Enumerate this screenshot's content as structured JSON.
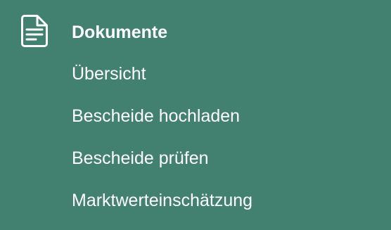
{
  "section": {
    "icon": "document-icon",
    "title": "Dokumente",
    "items": [
      {
        "label": "Übersicht"
      },
      {
        "label": "Bescheide hochladen"
      },
      {
        "label": "Bescheide prüfen"
      },
      {
        "label": "Marktwerteinschätzung"
      }
    ]
  },
  "colors": {
    "background": "#42806f",
    "text": "#ffffff"
  }
}
